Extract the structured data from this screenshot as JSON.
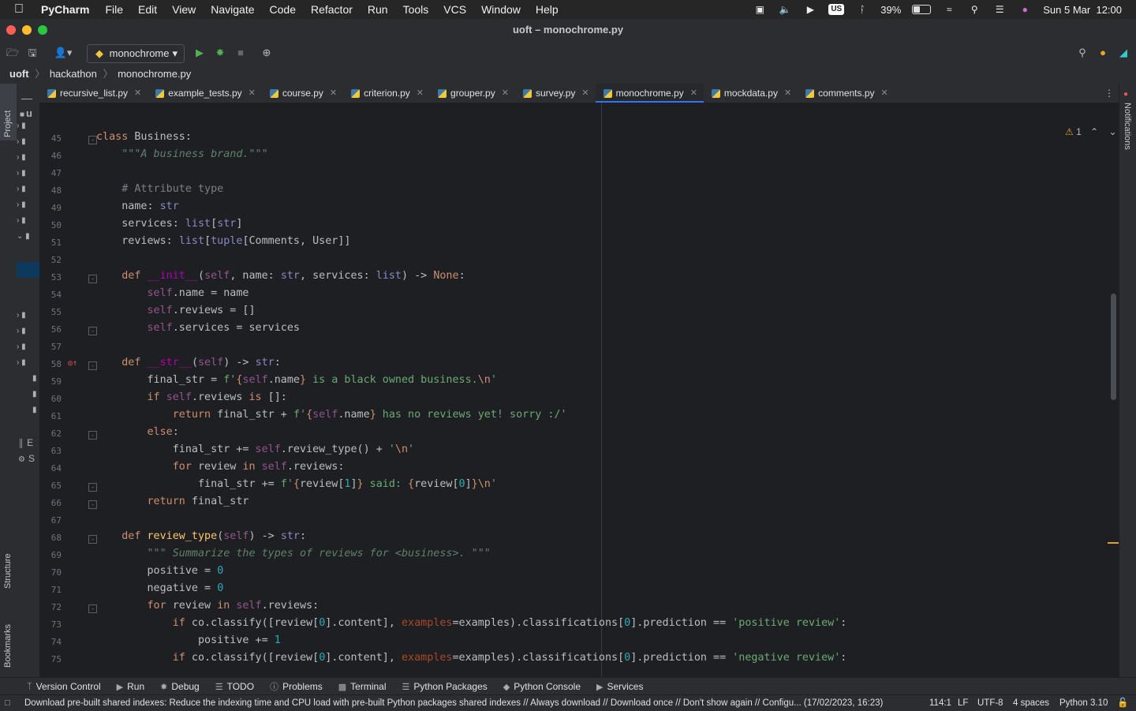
{
  "menubar": {
    "app_name": "PyCharm",
    "items": [
      "File",
      "Edit",
      "View",
      "Navigate",
      "Code",
      "Refactor",
      "Run",
      "Tools",
      "VCS",
      "Window",
      "Help"
    ],
    "input_source": "US",
    "battery_percent": "39%",
    "battery_level": 0.39,
    "clock": "Sun 5 Mar  12:00"
  },
  "window": {
    "title": "uoft – monochrome.py"
  },
  "toolbar": {
    "run_config": "monochrome"
  },
  "breadcrumb": [
    "uoft",
    "hackathon",
    "monochrome.py"
  ],
  "side_labels": {
    "project": "Project",
    "structure": "Structure",
    "bookmarks": "Bookmarks",
    "notifications": "Notifications"
  },
  "project_root_letter": "u",
  "project_partial": [
    "E",
    "S"
  ],
  "tabs": [
    {
      "label": "recursive_list.py",
      "active": false
    },
    {
      "label": "example_tests.py",
      "active": false
    },
    {
      "label": "course.py",
      "active": false
    },
    {
      "label": "criterion.py",
      "active": false
    },
    {
      "label": "grouper.py",
      "active": false
    },
    {
      "label": "survey.py",
      "active": false
    },
    {
      "label": "monochrome.py",
      "active": true
    },
    {
      "label": "mockdata.py",
      "active": false
    },
    {
      "label": "comments.py",
      "active": false
    }
  ],
  "inspection": {
    "warnings": "1"
  },
  "code": {
    "first_line": 45,
    "lines": [
      "class Business:",
      "    \"\"\"A business brand.\"\"\"",
      "",
      "    # Attribute type",
      "    name: str",
      "    services: list[str]",
      "    reviews: list[tuple[Comments, User]]",
      "",
      "    def __init__(self, name: str, services: list) -> None:",
      "        self.name = name",
      "        self.reviews = []",
      "        self.services = services",
      "",
      "    def __str__(self) -> str:",
      "        final_str = f'{self.name} is a black owned business.\\n'",
      "        if self.reviews is []:",
      "            return final_str + f'{self.name} has no reviews yet! sorry :/'",
      "        else:",
      "            final_str += self.review_type() + '\\n'",
      "            for review in self.reviews:",
      "                final_str += f'{review[1]} said: {review[0]}\\n'",
      "        return final_str",
      "",
      "    def review_type(self) -> str:",
      "        \"\"\" Summarize the types of reviews for <business>. \"\"\"",
      "        positive = 0",
      "        negative = 0",
      "        for review in self.reviews:",
      "            if co.classify([review[0].content], examples=examples).classifications[0].prediction == 'positive review':",
      "                positive += 1",
      "            if co.classify([review[0].content], examples=examples).classifications[0].prediction == 'negative review':"
    ]
  },
  "bottom_tools": [
    "Version Control",
    "Run",
    "Debug",
    "TODO",
    "Problems",
    "Terminal",
    "Python Packages",
    "Python Console",
    "Services"
  ],
  "status": {
    "message": "Download pre-built shared indexes: Reduce the indexing time and CPU load with pre-built Python packages shared indexes // Always download // Download once // Don't show again // Configu... (17/02/2023, 16:23)",
    "position": "114:1",
    "line_sep": "LF",
    "encoding": "UTF-8",
    "indent": "4 spaces",
    "interpreter": "Python 3.10"
  },
  "colors": {
    "accent": "#3574f0",
    "editor_bg": "#1e1f22",
    "panel_bg": "#2b2d30"
  }
}
